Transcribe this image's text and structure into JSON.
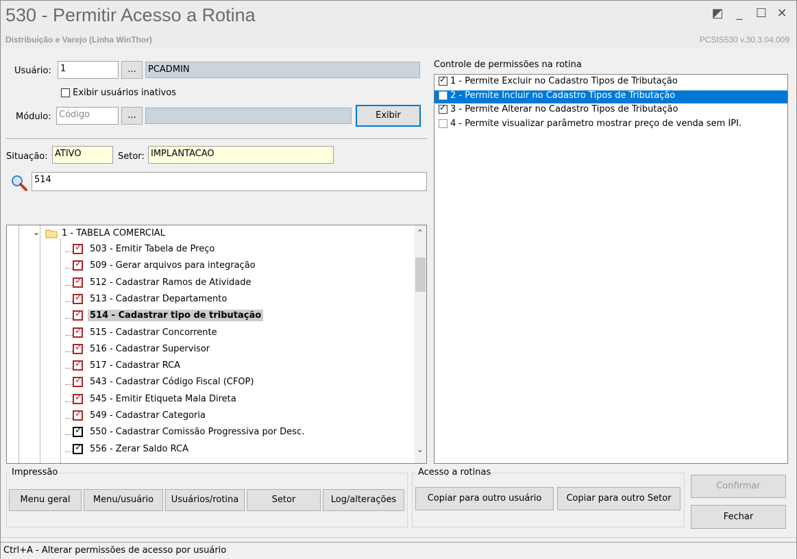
{
  "window": {
    "title": "530 - Permitir Acesso a Rotina",
    "subtitle": "Distribuição e Varejo (Linha WinThor)",
    "version": "PCSIS530  v.30.3.04.009"
  },
  "form": {
    "usuario_label": "Usuário:",
    "usuario_value": "1",
    "browse_label": "...",
    "usuario_name": "PCADMIN",
    "inativos_label": "Exibir usuários inativos",
    "modulo_label": "Módulo:",
    "modulo_placeholder": "Código",
    "modulo_name": "",
    "exibir_label": "Exibir",
    "situacao_label": "Situação:",
    "situacao_value": "ATIVO",
    "setor_label": "Setor:",
    "setor_value": "IMPLANTACAO",
    "search_value": "514"
  },
  "tree": {
    "folder_label": "1 - TABELA COMERCIAL",
    "items": [
      {
        "label": "503 - Emitir Tabela de Preço",
        "style": "red"
      },
      {
        "label": "509 - Gerar arquivos para integração",
        "style": "red"
      },
      {
        "label": "512 - Cadastrar Ramos de Atividade",
        "style": "red"
      },
      {
        "label": "513 - Cadastrar Departamento",
        "style": "red"
      },
      {
        "label": "514 - Cadastrar tipo de tributação",
        "style": "red",
        "selected": true
      },
      {
        "label": "515 - Cadastrar Concorrente",
        "style": "red"
      },
      {
        "label": "516 - Cadastrar Supervisor",
        "style": "red"
      },
      {
        "label": "517 - Cadastrar RCA",
        "style": "red"
      },
      {
        "label": "543 - Cadastrar Código Fiscal (CFOP)",
        "style": "red"
      },
      {
        "label": "545 - Emitir Etiqueta Mala Direta",
        "style": "red"
      },
      {
        "label": "549 - Cadastrar Categoria",
        "style": "red"
      },
      {
        "label": "550 - Cadastrar Comissão Progressiva por Desc.",
        "style": "black"
      },
      {
        "label": "556 - Zerar Saldo RCA",
        "style": "black"
      }
    ]
  },
  "permissions": {
    "title": "Controle de permissões na rotina",
    "items": [
      {
        "label": "1 - Permite Excluir no Cadastro Tipos de Tributação",
        "checked": true
      },
      {
        "label": "2 - Permite Incluir no Cadastro Tipos de Tributação",
        "checked": false,
        "selected": true
      },
      {
        "label": "3 - Permite Alterar no Cadastro Tipos de Tributação",
        "checked": true
      },
      {
        "label": "4 - Permite visualizar parâmetro mostrar preço de venda sem IPI.",
        "checked": false
      }
    ]
  },
  "impressao": {
    "title": "Impressão",
    "buttons": [
      "Menu geral",
      "Menu/usuário",
      "Usuários/rotina",
      "Setor",
      "Log/alterações"
    ]
  },
  "acesso": {
    "title": "Acesso a rotinas",
    "buttons": [
      "Copiar para outro usuário",
      "Copiar para outro Setor"
    ]
  },
  "actions": {
    "confirmar": "Confirmar",
    "fechar": "Fechar"
  },
  "status": {
    "text": "Ctrl+A - Alterar permissões de acesso por usuário"
  },
  "colors": {
    "selection": "#0078d7",
    "readonly_field": "#c9d4dd",
    "yellow_field": "#ffffe0",
    "red_check": "#b22222"
  }
}
